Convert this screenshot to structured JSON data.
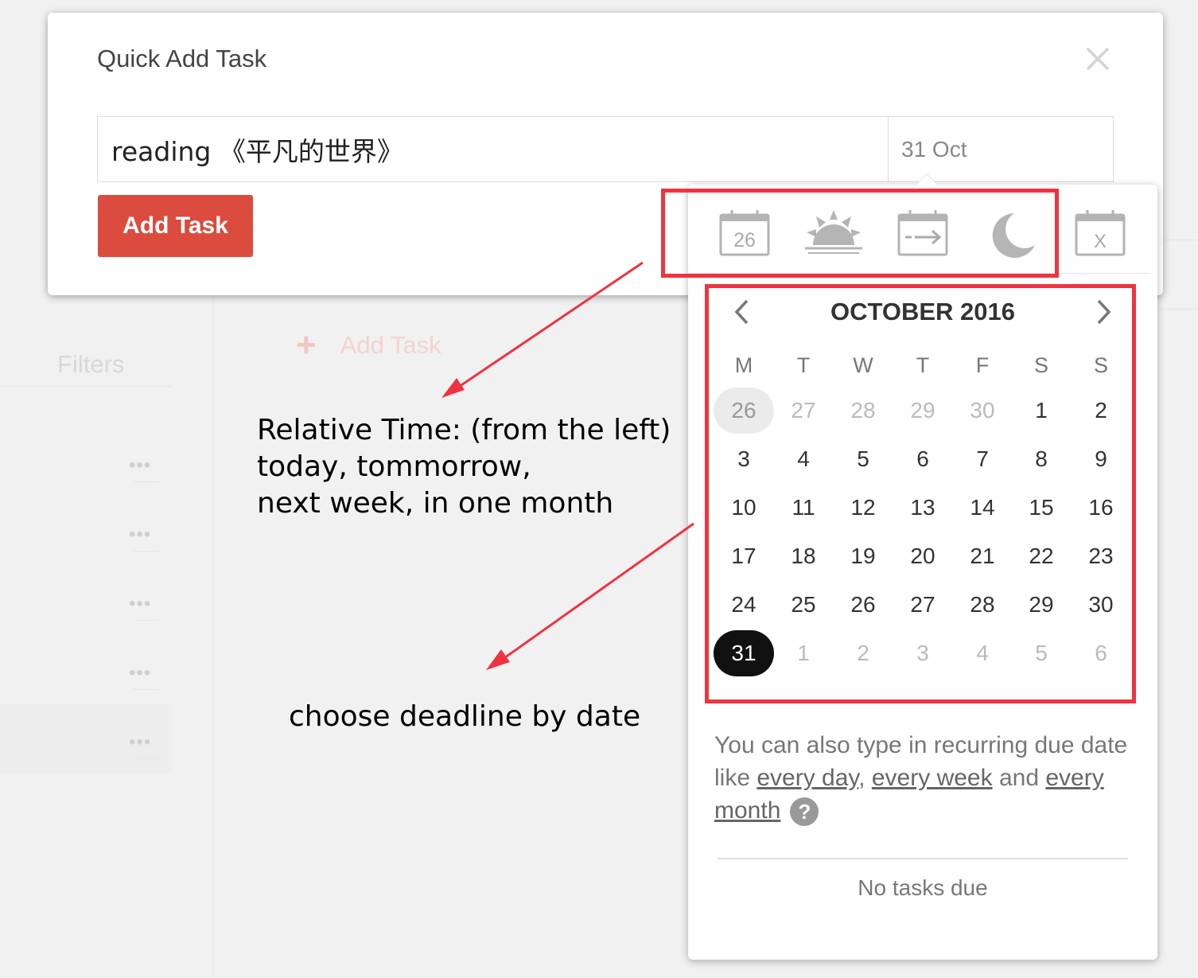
{
  "background": {
    "sidebar_heading": "Filters",
    "add_task_icon": "plus-icon",
    "add_task_label": "Add Task",
    "row_menu_icon": "more-dots-icon",
    "row_menu_glyph": "•••"
  },
  "modal": {
    "title": "Quick Add Task",
    "close_icon": "close-icon",
    "close_glyph": "✕",
    "task_input_value": "reading 《平凡的世界》",
    "date_value": "31 Oct",
    "submit_label": "Add Task",
    "submit_color": "#db4c3f"
  },
  "scheduler": {
    "quick_options": [
      {
        "name": "today",
        "icon": "calendar-today-icon",
        "label": "26"
      },
      {
        "name": "tomorrow",
        "icon": "sunrise-icon"
      },
      {
        "name": "next-week",
        "icon": "calendar-arrow-icon"
      },
      {
        "name": "in-one-month",
        "icon": "moon-icon"
      },
      {
        "name": "no-date",
        "icon": "calendar-x-icon",
        "label": "X"
      }
    ],
    "month_label": "OCTOBER 2016",
    "prev_icon": "chevron-left-icon",
    "next_icon": "chevron-right-icon",
    "weekdays": [
      "M",
      "T",
      "W",
      "T",
      "F",
      "S",
      "S"
    ],
    "weeks": [
      [
        {
          "d": "26",
          "s": "today"
        },
        {
          "d": "27",
          "s": "other"
        },
        {
          "d": "28",
          "s": "other"
        },
        {
          "d": "29",
          "s": "other"
        },
        {
          "d": "30",
          "s": "other"
        },
        {
          "d": "1",
          "s": "cur"
        },
        {
          "d": "2",
          "s": "cur"
        }
      ],
      [
        {
          "d": "3",
          "s": "cur"
        },
        {
          "d": "4",
          "s": "cur"
        },
        {
          "d": "5",
          "s": "cur"
        },
        {
          "d": "6",
          "s": "cur"
        },
        {
          "d": "7",
          "s": "cur"
        },
        {
          "d": "8",
          "s": "cur"
        },
        {
          "d": "9",
          "s": "cur"
        }
      ],
      [
        {
          "d": "10",
          "s": "cur"
        },
        {
          "d": "11",
          "s": "cur"
        },
        {
          "d": "12",
          "s": "cur"
        },
        {
          "d": "13",
          "s": "cur"
        },
        {
          "d": "14",
          "s": "cur"
        },
        {
          "d": "15",
          "s": "cur"
        },
        {
          "d": "16",
          "s": "cur"
        }
      ],
      [
        {
          "d": "17",
          "s": "cur"
        },
        {
          "d": "18",
          "s": "cur"
        },
        {
          "d": "19",
          "s": "cur"
        },
        {
          "d": "20",
          "s": "cur"
        },
        {
          "d": "21",
          "s": "cur"
        },
        {
          "d": "22",
          "s": "cur"
        },
        {
          "d": "23",
          "s": "cur"
        }
      ],
      [
        {
          "d": "24",
          "s": "cur"
        },
        {
          "d": "25",
          "s": "cur"
        },
        {
          "d": "26",
          "s": "cur"
        },
        {
          "d": "27",
          "s": "cur"
        },
        {
          "d": "28",
          "s": "cur"
        },
        {
          "d": "29",
          "s": "cur"
        },
        {
          "d": "30",
          "s": "cur"
        }
      ],
      [
        {
          "d": "31",
          "s": "selected"
        },
        {
          "d": "1",
          "s": "other"
        },
        {
          "d": "2",
          "s": "other"
        },
        {
          "d": "3",
          "s": "other"
        },
        {
          "d": "4",
          "s": "other"
        },
        {
          "d": "5",
          "s": "other"
        },
        {
          "d": "6",
          "s": "other"
        }
      ]
    ],
    "hint": {
      "prefix": "You can also type in recurring due date like ",
      "link1": "every day",
      "sep1": ", ",
      "link2": "every week",
      "sep2": " and ",
      "link3": "every month",
      "help_icon": "help-icon",
      "help_glyph": "?"
    },
    "footer": "No tasks due"
  },
  "annotations": {
    "color": "#ef3341",
    "relative_time": [
      "Relative Time: (from the left)",
      "today, tommorrow,",
      "next week, in one month"
    ],
    "choose_date": "choose deadline by date"
  }
}
